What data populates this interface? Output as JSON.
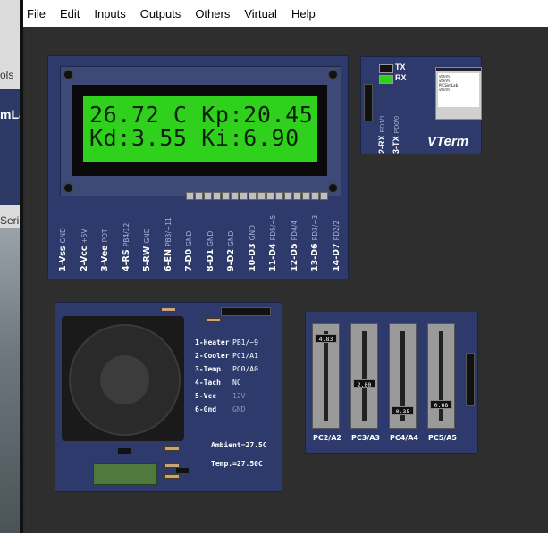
{
  "menu": [
    "File",
    "Edit",
    "Inputs",
    "Outputs",
    "Others",
    "Virtual",
    "Help"
  ],
  "background_window": {
    "fragments": [
      "ols",
      "mLa",
      "Seria"
    ]
  },
  "lcd": {
    "line1": "26.72 C Kp:20.45",
    "line2": "Kd:3.55 Ki:6.90",
    "pins": [
      {
        "label": "1-Vss",
        "signal": "GND"
      },
      {
        "label": "2-Vcc",
        "signal": "+5V"
      },
      {
        "label": "3-Vee",
        "signal": "POT"
      },
      {
        "label": "4-RS",
        "signal": "PB4/12"
      },
      {
        "label": "5-RW",
        "signal": "GND"
      },
      {
        "label": "6-EN",
        "signal": "PB3/~11"
      },
      {
        "label": "7-D0",
        "signal": "GND"
      },
      {
        "label": "8-D1",
        "signal": "GND"
      },
      {
        "label": "9-D2",
        "signal": "GND"
      },
      {
        "label": "10-D3",
        "signal": "GND"
      },
      {
        "label": "11-D4",
        "signal": "PD5/~5"
      },
      {
        "label": "12-D5",
        "signal": "PD4/4"
      },
      {
        "label": "13-D6",
        "signal": "PD3/~3"
      },
      {
        "label": "14-D7",
        "signal": "PD2/2"
      }
    ]
  },
  "vterm": {
    "tx": "TX",
    "rx": "RX",
    "title": "VTerm",
    "pin_rx": {
      "label": "2-RX",
      "signal": "PD1/1"
    },
    "pin_tx": {
      "label": "3-TX",
      "signal": "PD0/0"
    },
    "screen_lines": [
      "vterm",
      "vterm",
      "PICSimLab",
      "vterm"
    ]
  },
  "heater": {
    "legend": [
      {
        "label": "1-Heater",
        "value": "PB1/~9"
      },
      {
        "label": "2-Cooler",
        "value": "PC1/A1"
      },
      {
        "label": "3-Temp.",
        "value": "PC0/A0"
      },
      {
        "label": "4-Tach",
        "value": "NC"
      },
      {
        "label": "5-Vcc",
        "value": "12V"
      },
      {
        "label": "6-Gnd",
        "value": "GND"
      }
    ],
    "ambient": "Ambient=27.5C",
    "temp": "Temp.=27.50C"
  },
  "pots": [
    {
      "label": "PC2/A2",
      "value": "4.83",
      "level": 0.97
    },
    {
      "label": "PC3/A3",
      "value": "2.00",
      "level": 0.4
    },
    {
      "label": "PC4/A4",
      "value": "0.35",
      "level": 0.07
    },
    {
      "label": "PC5/A5",
      "value": "0.68",
      "level": 0.14
    }
  ]
}
